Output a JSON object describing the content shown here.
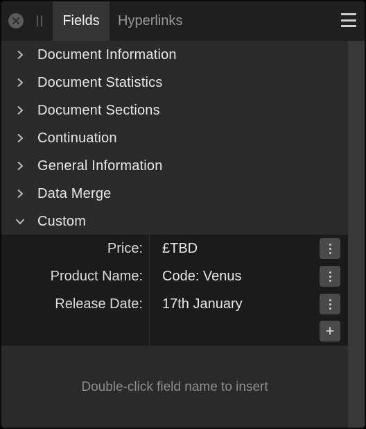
{
  "header": {
    "tabs": [
      {
        "label": "Fields",
        "active": true
      },
      {
        "label": "Hyperlinks",
        "active": false
      }
    ]
  },
  "sections": [
    {
      "label": "Document Information",
      "expanded": false
    },
    {
      "label": "Document Statistics",
      "expanded": false
    },
    {
      "label": "Document Sections",
      "expanded": false
    },
    {
      "label": "Continuation",
      "expanded": false
    },
    {
      "label": "General Information",
      "expanded": false
    },
    {
      "label": "Data Merge",
      "expanded": false
    },
    {
      "label": "Custom",
      "expanded": true
    }
  ],
  "custom_fields": [
    {
      "name": "Price:",
      "value": "£TBD"
    },
    {
      "name": "Product Name:",
      "value": "Code: Venus"
    },
    {
      "name": "Release Date:",
      "value": "17th January"
    }
  ],
  "add_button_label": "+",
  "footer": {
    "hint": "Double-click field name to insert"
  },
  "colors": {
    "panel_bg": "#2a2a2a",
    "header_bg": "#1f1f1f",
    "table_bg": "#1b1b1b",
    "button_bg": "#4a4a4a"
  },
  "icons": {
    "close": "close-icon",
    "grip": "grip-icon",
    "menu": "hamburger-menu-icon",
    "collapsed": "chevron-right-icon",
    "expanded": "chevron-down-icon",
    "more": "kebab-icon"
  }
}
